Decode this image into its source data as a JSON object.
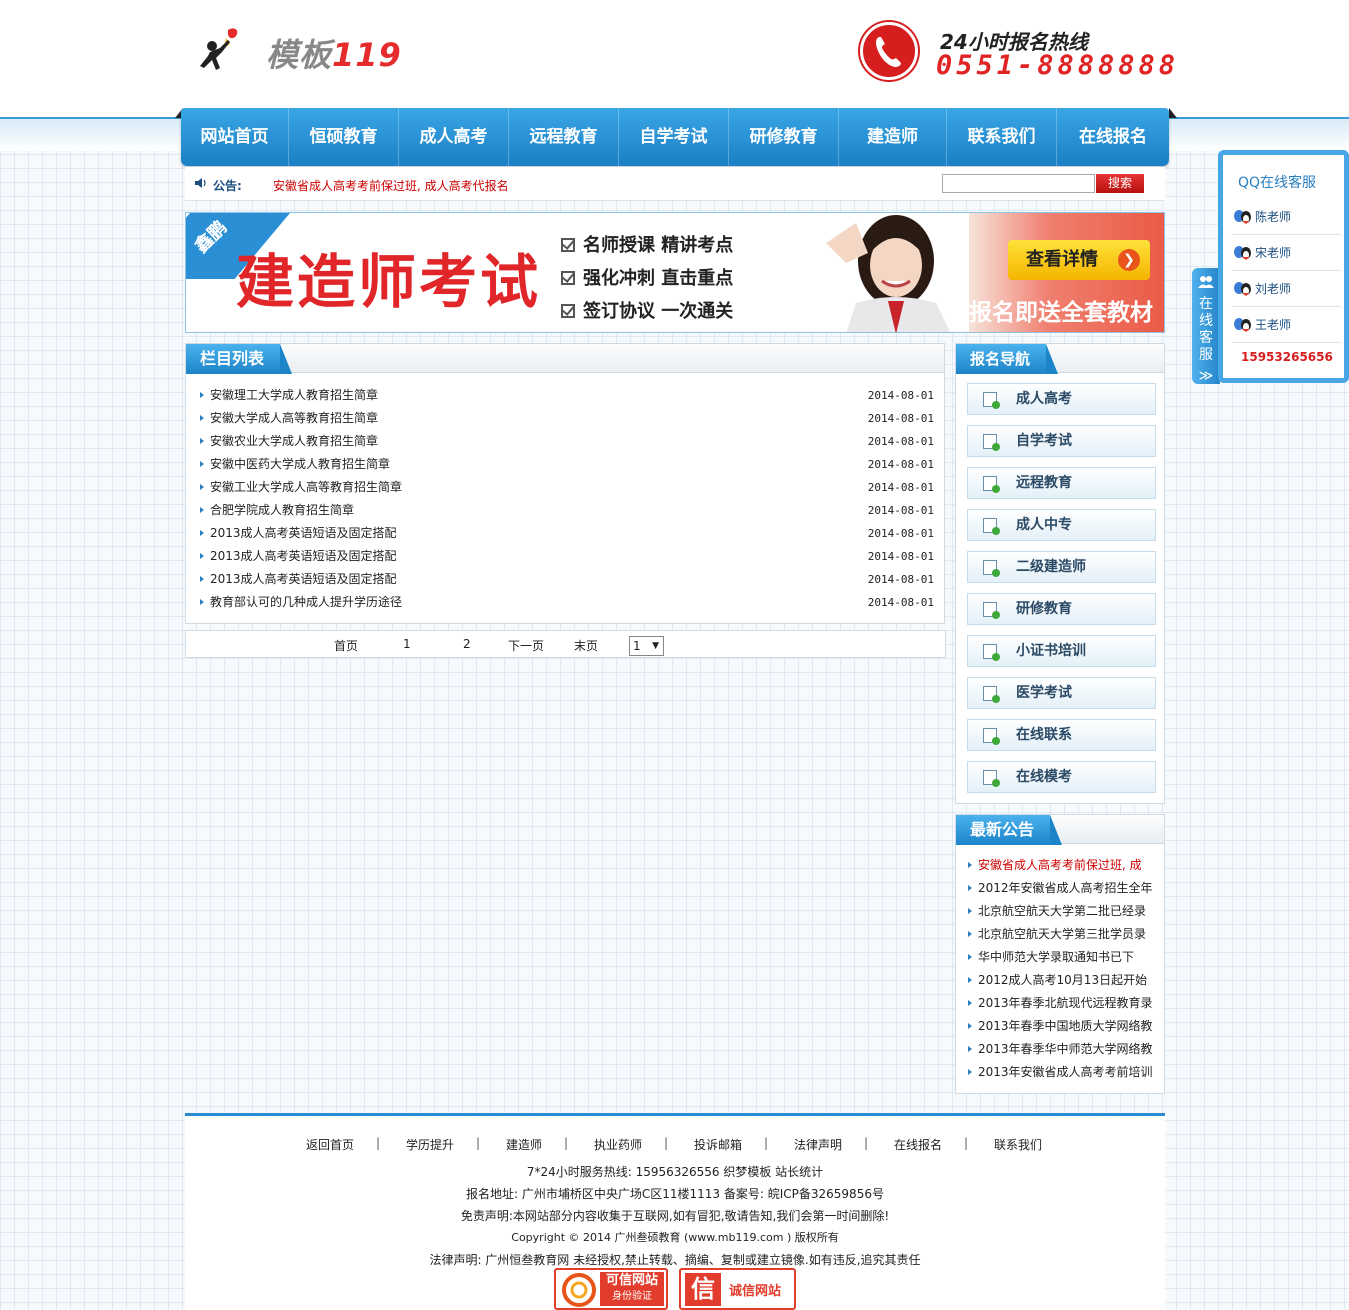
{
  "header": {
    "logo_text": "模板",
    "logo_num": "119",
    "hotline_label": "24小时报名热线",
    "hotline_number": "0551-8888888"
  },
  "nav": [
    "网站首页",
    "恒硕教育",
    "成人高考",
    "远程教育",
    "自学考试",
    "研修教育",
    "建造师",
    "联系我们",
    "在线报名"
  ],
  "notice": {
    "label": "公告:",
    "text": "安徽省成人高考考前保过班, 成人高考代报名",
    "search_button": "搜索"
  },
  "banner": {
    "tag": "鑫鹏",
    "title": "建造师考试",
    "points": [
      "名师授课  精讲考点",
      "强化冲刺  直击重点",
      "签订协议  一次通关"
    ],
    "button": "查看详情",
    "slogan": "报名即送全套教材"
  },
  "main": {
    "title": "栏目列表",
    "items": [
      {
        "title": "安徽理工大学成人教育招生简章",
        "date": "2014-08-01"
      },
      {
        "title": "安徽大学成人高等教育招生简章",
        "date": "2014-08-01"
      },
      {
        "title": "安徽农业大学成人教育招生简章",
        "date": "2014-08-01"
      },
      {
        "title": "安徽中医药大学成人教育招生简章",
        "date": "2014-08-01"
      },
      {
        "title": "安徽工业大学成人高等教育招生简章",
        "date": "2014-08-01"
      },
      {
        "title": "合肥学院成人教育招生简章",
        "date": "2014-08-01"
      },
      {
        "title": "2013成人高考英语短语及固定搭配",
        "date": "2014-08-01"
      },
      {
        "title": "2013成人高考英语短语及固定搭配",
        "date": "2014-08-01"
      },
      {
        "title": "2013成人高考英语短语及固定搭配",
        "date": "2014-08-01"
      },
      {
        "title": "教育部认可的几种成人提升学历途径",
        "date": "2014-08-01"
      }
    ]
  },
  "pager": {
    "first": "首页",
    "p1": "1",
    "p2": "2",
    "next": "下一页",
    "last": "末页",
    "select": "1"
  },
  "sidebar": {
    "nav_title": "报名导航",
    "nav_items": [
      "成人高考",
      "自学考试",
      "远程教育",
      "成人中专",
      "二级建造师",
      "研修教育",
      "小证书培训",
      "医学考试",
      "在线联系",
      "在线模考"
    ],
    "ann_title": "最新公告",
    "announcements": [
      "安徽省成人高考考前保过班, 成",
      "2012年安徽省成人高考招生全年",
      "北京航空航天大学第二批已经录",
      "北京航空航天大学第三批学员录",
      "华中师范大学录取通知书已下",
      "2012成人高考10月13日起开始",
      "2013年春季北航现代远程教育录",
      "2013年春季中国地质大学网络教",
      "2013年春季华中师范大学网络教",
      "2013年安徽省成人高考考前培训"
    ]
  },
  "footer": {
    "links": [
      "返回首页",
      "学历提升",
      "建造师",
      "执业药师",
      "投诉邮箱",
      "法律声明",
      "在线报名",
      "联系我们"
    ],
    "separator": "|",
    "line1": "7*24小时服务热线: 15956326556 织梦模板 站长统计",
    "line2": "报名地址: 广州市埔桥区中央广场C区11楼1113 备案号: 皖ICP备32659856号",
    "line3": "免责声明:本网站部分内容收集于互联网,如有冒犯,敬请告知,我们会第一时间删除!",
    "line4": "Copyright © 2014 广州叁硕教育 (www.mb119.com ) 版权所有",
    "line5": "法律声明: 广州恒叁教育网 未经授权,禁止转载、摘编、复制或建立镜像.如有违反,追究其责任",
    "badge1_title": "可信网站",
    "badge1_sub": "身份验证",
    "badge2_char": "信",
    "badge2_title": "诚信网站"
  },
  "qq": {
    "title": "QQ在线客服",
    "agents": [
      "陈老师",
      "宋老师",
      "刘老师",
      "王老师"
    ],
    "phone": "15953265656",
    "tab": "在线客服",
    "tab_arrow": "≫"
  },
  "colors": {
    "primary_blue": "#2a8bd0",
    "accent_red": "#e1262a",
    "notice_red": "#cc0000"
  }
}
